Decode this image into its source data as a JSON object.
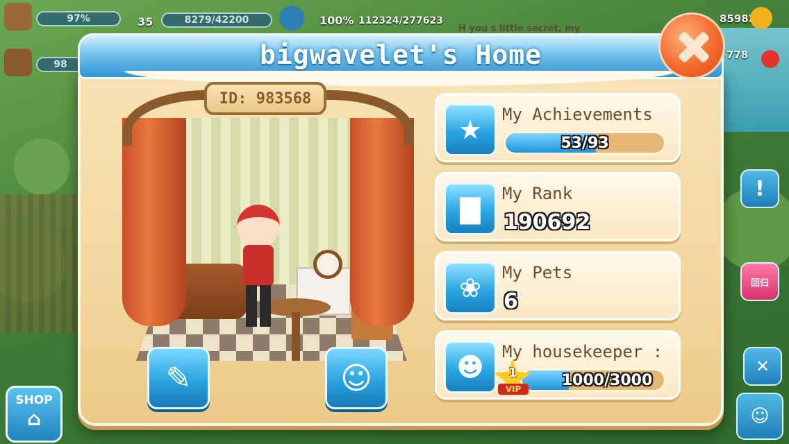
{
  "hud": {
    "energy_percent_label": "97%",
    "level": "35",
    "xp": "8279/42200",
    "progress_percent_label": "100%",
    "exp_total": "112324/277623",
    "second_bar_label": "98",
    "coins": "85982",
    "gems": "778",
    "chat_snippet": "H you s little secret, my"
  },
  "dialog": {
    "title": "bigwavelet's Home",
    "player_id_label": "ID: 983568"
  },
  "cards": {
    "achievements": {
      "label": "My Achievements",
      "value": "53/93",
      "fill_fraction": 0.57
    },
    "rank": {
      "label": "My Rank",
      "value": "190692"
    },
    "pets": {
      "label": "My Pets",
      "value": "6"
    },
    "housekeeper": {
      "label": "My housekeeper :",
      "value": "1000/3000",
      "fill_fraction": 0.33,
      "vip_level": "1",
      "vip_label": "VIP"
    }
  },
  "side": {
    "shop_label": "SHOP",
    "back_label": "回归"
  },
  "icons": {
    "achievements": "star-icon",
    "rank": "podium-icon",
    "pets": "paw-icon",
    "housekeeper": "housekeeper-icon",
    "edit": "edit-note-icon",
    "visit": "visit-avatar-icon",
    "close": "close-icon"
  },
  "colors": {
    "accent_blue": "#2aa3e0",
    "close_orange": "#f46a2e",
    "panel_cream": "#f6e3b7"
  }
}
